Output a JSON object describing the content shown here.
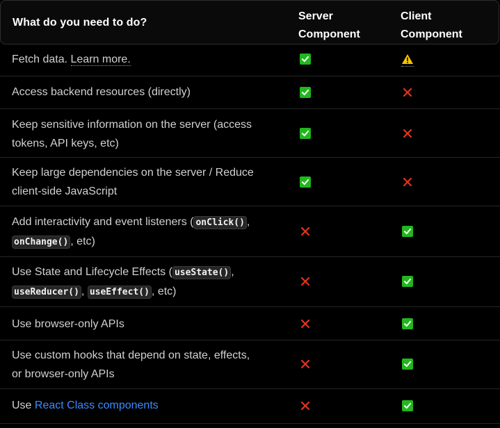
{
  "header": {
    "task": "What do you need to do?",
    "server_line1": "Server",
    "server_line2": "Component",
    "client_line1": "Client",
    "client_line2": "Component"
  },
  "rows": {
    "r0": {
      "text": "Fetch data.",
      "link": "Learn more.",
      "server": "check",
      "client": "warning"
    },
    "r1": {
      "text": "Access backend resources (directly)",
      "server": "check",
      "client": "cross"
    },
    "r2": {
      "line1": "Keep sensitive information on the server (access",
      "line2": "tokens, API keys, etc)",
      "server": "check",
      "client": "cross"
    },
    "r3": {
      "line1": "Keep large dependencies on the server / Reduce",
      "line2": "client-side JavaScript",
      "server": "check",
      "client": "cross"
    },
    "r4": {
      "pre": "Add interactivity and event listeners (",
      "code1": "onClick()",
      "sep": ",",
      "code2": "onChange()",
      "post": ", etc)",
      "server": "cross",
      "client": "check"
    },
    "r5": {
      "pre": "Use State and Lifecycle Effects (",
      "code1": "useState()",
      "sep1": ",",
      "code2": "useReducer()",
      "sep2": ",",
      "code3": "useEffect()",
      "post": ", etc)",
      "server": "cross",
      "client": "check"
    },
    "r6": {
      "text": "Use browser-only APIs",
      "server": "cross",
      "client": "check"
    },
    "r7": {
      "line1": "Use custom hooks that depend on state, effects,",
      "line2": "or browser-only APIs",
      "server": "cross",
      "client": "check"
    },
    "r8": {
      "pre": "Use ",
      "link": "React Class components",
      "server": "cross",
      "client": "check"
    }
  },
  "colors": {
    "check_green": "#21b71d",
    "cross_red": "#e5341f",
    "warning_yellow": "#f5c400",
    "link_blue": "#3b8cff"
  }
}
